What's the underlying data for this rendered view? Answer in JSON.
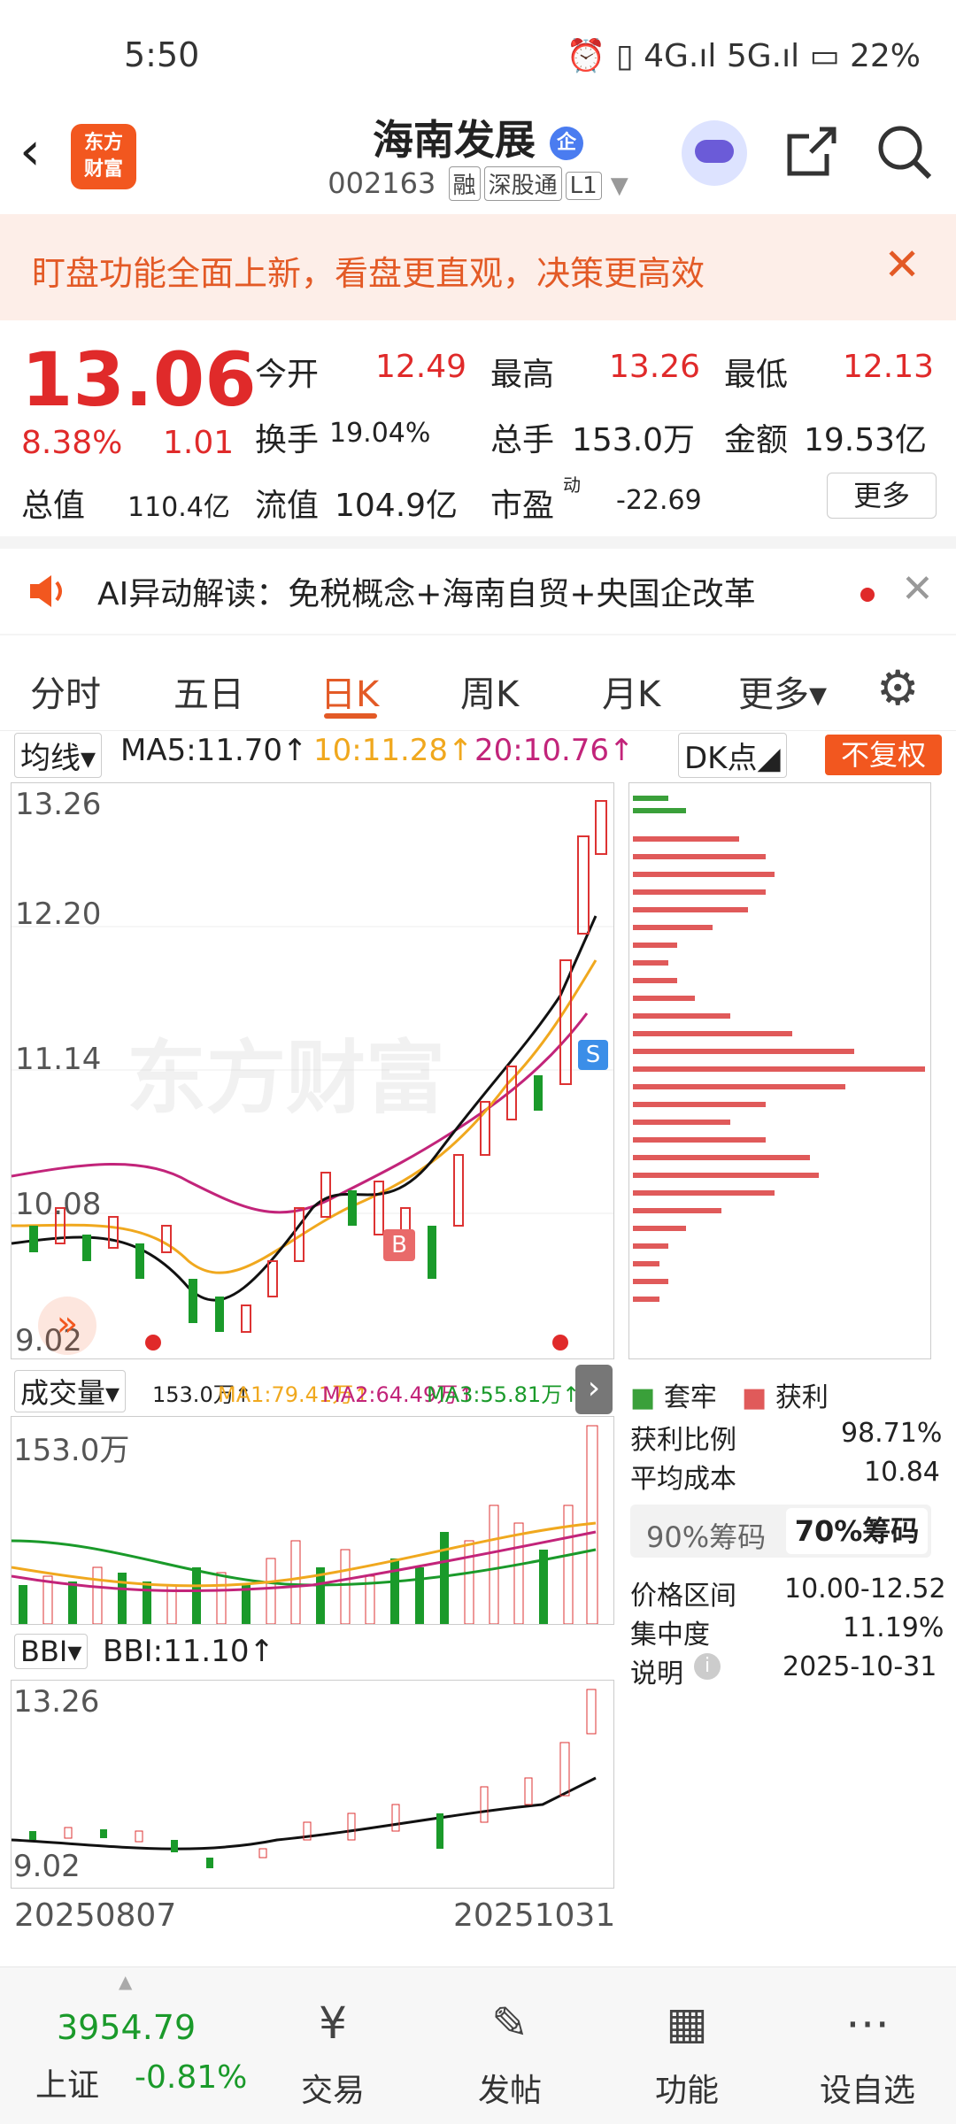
{
  "status_bar": {
    "time": "5:50",
    "right": "⏰ ▯ 4G.ıl 5G.ıl ▭ 22%"
  },
  "header": {
    "logo_line1": "东方",
    "logo_line2": "财富",
    "title": "海南发展",
    "title_badge": "企",
    "code": "002163",
    "tags": [
      "融",
      "深股通",
      "L1"
    ]
  },
  "banner": {
    "text": "盯盘功能全面上新，看盘更直观，决策更高效",
    "close": "✕"
  },
  "quote": {
    "price": "13.06",
    "change_pct": "8.38%",
    "change": "1.01",
    "open_label": "今开",
    "open": "12.49",
    "high_label": "最高",
    "high": "13.26",
    "low_label": "最低",
    "low": "12.13",
    "turnover_label": "换手",
    "turnover": "19.04%",
    "volume_label": "总手",
    "volume": "153.0万",
    "amount_label": "金额",
    "amount": "19.53亿",
    "mktcap_label": "总值",
    "mktcap": "110.4亿",
    "float_label": "流值",
    "float": "104.9亿",
    "pe_label": "市盈",
    "pe_sup": "动",
    "pe": "-22.69",
    "more": "更多"
  },
  "ai": {
    "text": "AI异动解读：免税概念+海南自贸+央国企改革"
  },
  "tabs": [
    "分时",
    "五日",
    "日K",
    "周K",
    "月K",
    "更多▾"
  ],
  "active_tab": "日K",
  "ma": {
    "selector": "均线▾",
    "ma5": "MA5:11.70↑",
    "ma10": "10:11.28↑",
    "ma20": "20:10.76↑",
    "dk": "DK点◢",
    "fq": "不复权"
  },
  "kline_axis": [
    "13.26",
    "12.20",
    "11.14",
    "10.08",
    "9.02"
  ],
  "volume_row": {
    "selector": "成交量▾",
    "vol": "153.0万↑",
    "ma1": "MA1:79.41万↑",
    "ma2": "MA2:64.49万↑",
    "ma3": "MA3:55.81万↑",
    "axis_top": "153.0万"
  },
  "bbi_row": {
    "selector": "BBI▾",
    "bbi": "BBI:11.10↑",
    "axis_top": "13.26",
    "axis_bottom": "9.02"
  },
  "dates": {
    "start": "20250807",
    "end": "20251031"
  },
  "chip": {
    "legend_trapped": "套牢",
    "legend_profit": "获利",
    "profit_ratio_label": "获利比例",
    "profit_ratio": "98.71%",
    "avg_cost_label": "平均成本",
    "avg_cost": "10.84",
    "tab90": "90%筹码",
    "tab70": "70%筹码",
    "range_label": "价格区间",
    "range": "10.00-12.52",
    "concentration_label": "集中度",
    "concentration": "11.19%",
    "note_label": "说明",
    "note": "2025-10-31"
  },
  "markers": {
    "b": "B",
    "s": "S"
  },
  "watermark": "东方财富",
  "bottom": {
    "index_value": "3954.79",
    "index_name": "上证",
    "index_change": "-0.81%",
    "items": [
      "交易",
      "发帖",
      "功能",
      "设自选"
    ]
  }
}
